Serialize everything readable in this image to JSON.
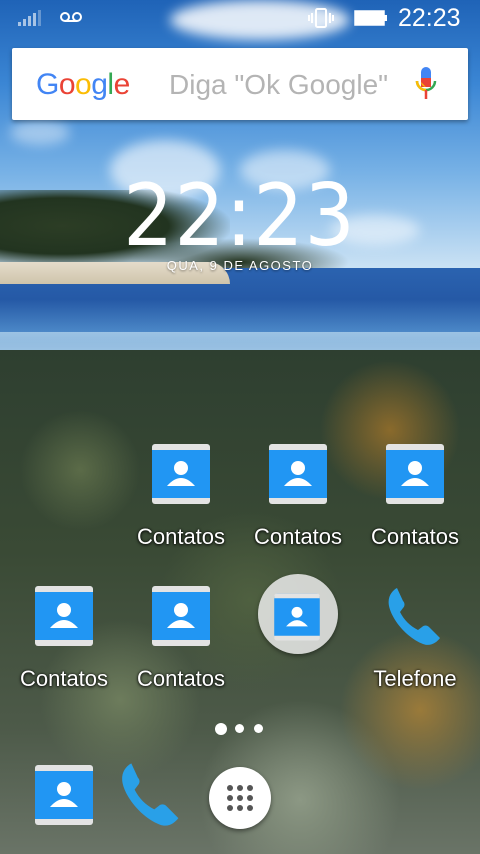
{
  "status_bar": {
    "time": "22:23",
    "icons": [
      "signal-icon",
      "voicemail-icon",
      "vibrate-icon",
      "battery-icon"
    ]
  },
  "search": {
    "logo_text": "Google",
    "hint": "Diga \"Ok Google\"",
    "mic_icon": "mic-icon"
  },
  "clock_widget": {
    "time": "22:23",
    "date": "QUA, 9 DE AGOSTO"
  },
  "apps": {
    "row1": [
      {
        "label": "Contatos",
        "icon": "contacts-icon"
      },
      {
        "label": "Contatos",
        "icon": "contacts-icon"
      },
      {
        "label": "Contatos",
        "icon": "contacts-icon"
      }
    ],
    "row2": [
      {
        "label": "Contatos",
        "icon": "contacts-icon"
      },
      {
        "label": "Contatos",
        "icon": "contacts-icon"
      },
      {
        "label": "",
        "icon": "contacts-folder-icon"
      },
      {
        "label": "Telefone",
        "icon": "phone-icon"
      }
    ]
  },
  "page_indicator": {
    "pages": 3,
    "current": 1
  },
  "dock": [
    {
      "icon": "contacts-icon"
    },
    {
      "icon": "phone-icon"
    },
    {
      "icon": "all-apps-icon"
    }
  ],
  "colors": {
    "contacts_blue": "#2196f3",
    "phone_blue": "#29a0e8",
    "google_blue": "#4285f4",
    "google_red": "#ea4335",
    "google_yellow": "#fbbc05",
    "google_green": "#34a853"
  }
}
